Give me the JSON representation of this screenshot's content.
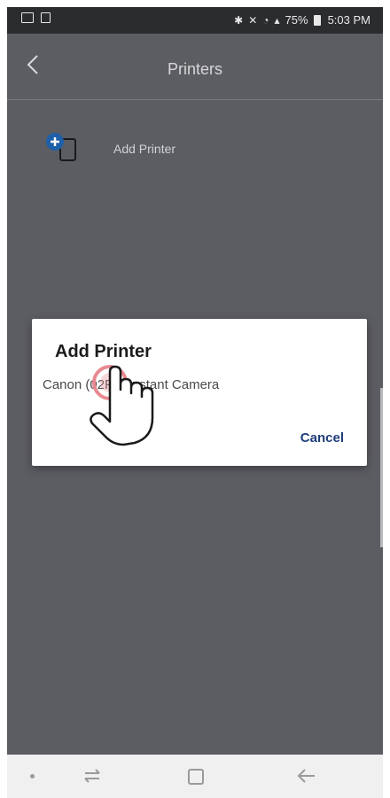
{
  "status_bar": {
    "battery_text": "75%",
    "time": "5:03 PM",
    "left_icons": [
      "gallery-icon",
      "screenshot-icon"
    ],
    "right_icons": [
      "bluetooth-icon",
      "mute-icon",
      "wifi-icon",
      "signal-icon",
      "battery-icon"
    ]
  },
  "app_bar": {
    "title": "Printers",
    "back_icon": "chevron-left-icon"
  },
  "printers": {
    "add_label": "Add Printer",
    "add_icon": "add-printer-icon"
  },
  "dialog": {
    "title": "Add Printer",
    "items": [
      {
        "label": "Canon (02F5) Instant Camera"
      }
    ],
    "cancel_label": "Cancel"
  },
  "nav_bar": {
    "icons": [
      "dot-icon",
      "recent-apps-icon",
      "home-icon",
      "back-arrow-icon"
    ]
  },
  "colors": {
    "screen_bg": "#5c5d63",
    "accent_blue": "#1f5fa8",
    "cancel_text": "#1e3d7a",
    "tap_ring": "#e88a92"
  }
}
